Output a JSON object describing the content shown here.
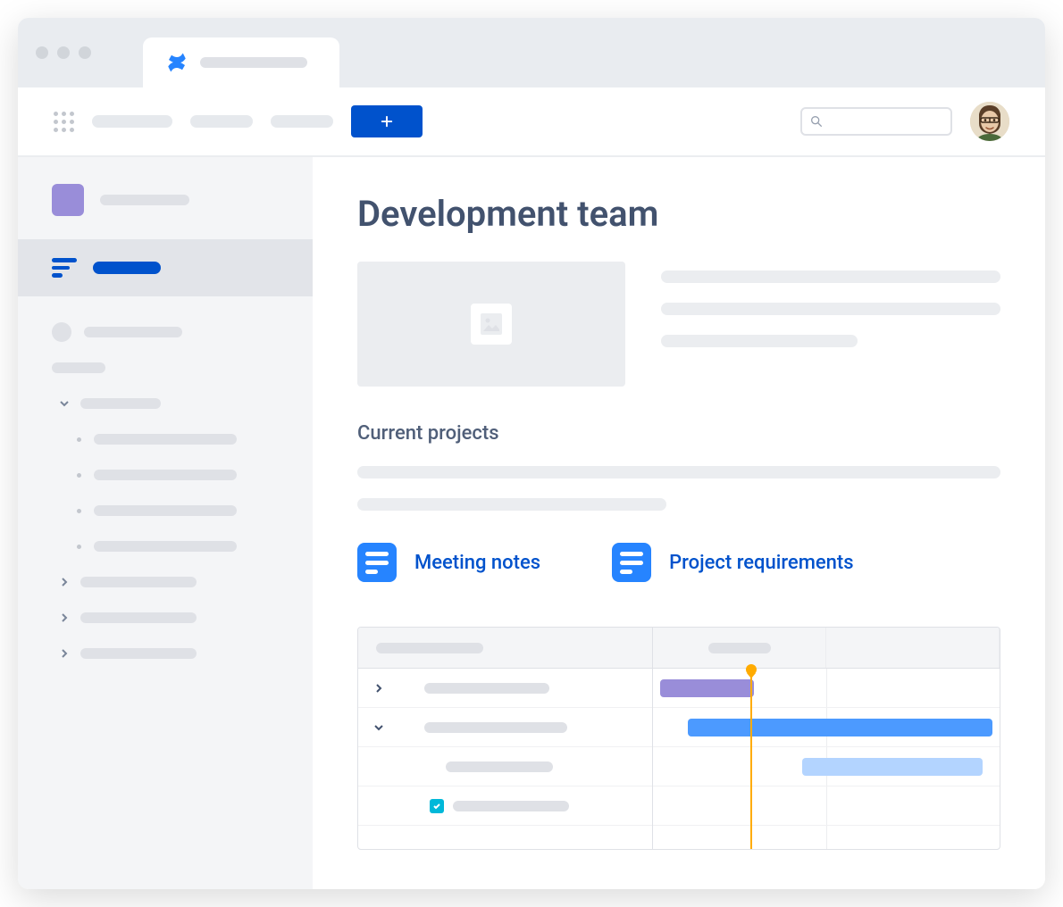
{
  "page": {
    "title": "Development team",
    "section_title": "Current projects"
  },
  "doc_links": {
    "meeting_notes": "Meeting notes",
    "project_requirements": "Project requirements"
  },
  "colors": {
    "primary": "#0052cc",
    "accent_purple": "#998dd9",
    "accent_blue": "#4c9aff",
    "accent_lightblue": "#b3d4ff",
    "today_marker": "#ffab00",
    "teal_check": "#00b8d9"
  }
}
